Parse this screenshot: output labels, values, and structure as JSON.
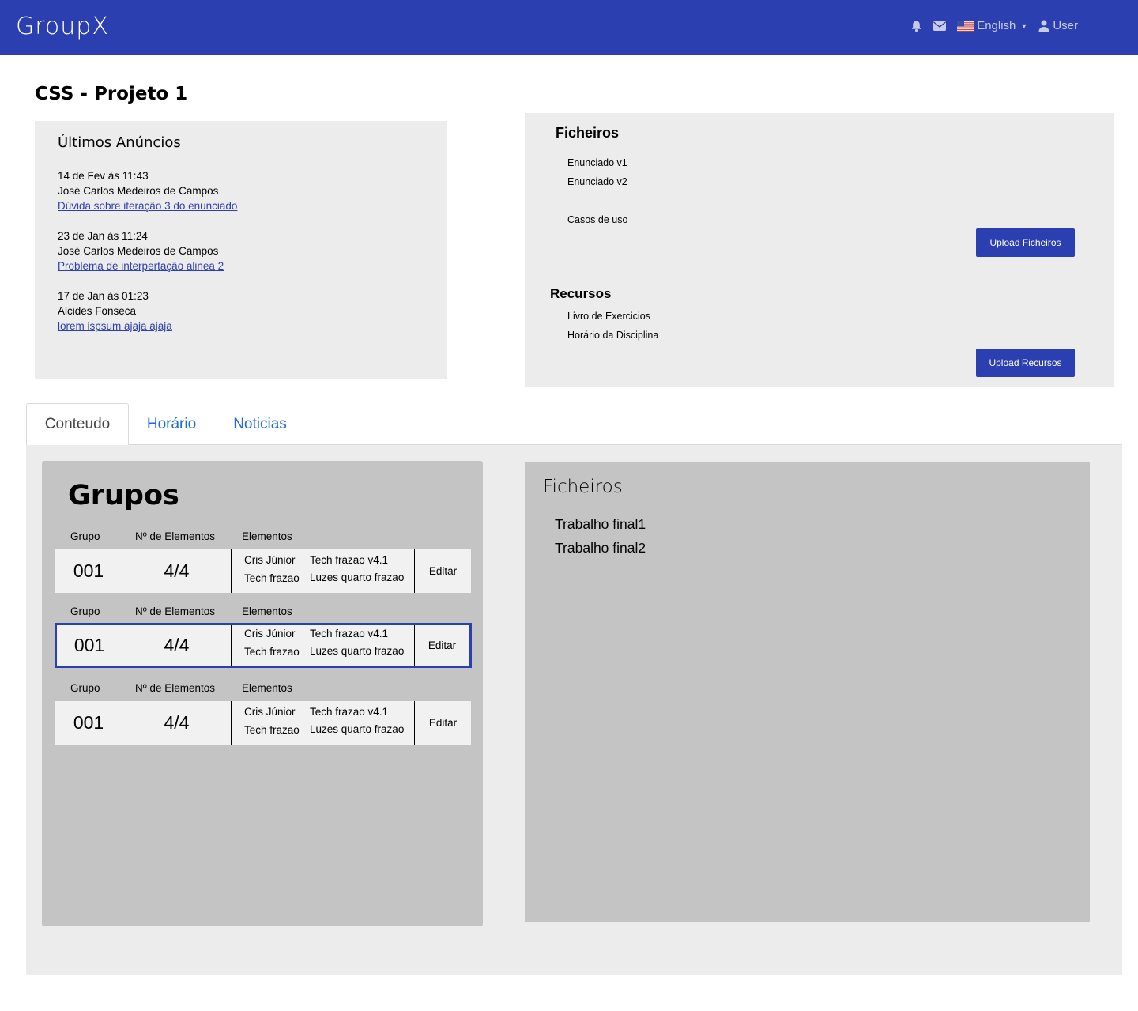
{
  "header": {
    "logo": "GroupX",
    "language": "English",
    "user": "User"
  },
  "page_title": "CSS - Projeto 1",
  "anuncios": {
    "title": "Últimos Anúncios",
    "items": [
      {
        "date": "14 de Fev às 11:43",
        "author": "José Carlos Medeiros de Campos",
        "link": "Dúvida sobre iteração 3 do enunciado"
      },
      {
        "date": "23 de Jan às 11:24",
        "author": "José Carlos Medeiros de Campos",
        "link": "Problema de interpertação alinea 2"
      },
      {
        "date": "17 de Jan às 01:23",
        "author": "Alcides Fonseca",
        "link": "lorem ispsum ajaja ajaja"
      }
    ]
  },
  "ficheiros_top": {
    "title": "Ficheiros",
    "files": [
      "Enunciado v1",
      "Enunciado v2",
      "Casos de uso"
    ],
    "upload_label": "Upload Ficheiros"
  },
  "recursos": {
    "title": "Recursos",
    "items": [
      "Livro de Exercicios",
      "Horário da Disciplina"
    ],
    "upload_label": "Upload Recursos"
  },
  "tabs": [
    "Conteudo",
    "Horário",
    "Noticias"
  ],
  "grupos": {
    "title": "Grupos",
    "headers": {
      "grupo": "Grupo",
      "n_elementos": "Nº de Elementos",
      "elementos": "Elementos"
    },
    "rows": [
      {
        "grupo": "001",
        "count": "4/4",
        "members": [
          "Cris Júnior",
          "Tech frazao v4.1",
          "Tech frazao",
          "Luzes quarto frazao"
        ],
        "action": "Editar"
      },
      {
        "grupo": "001",
        "count": "4/4",
        "members": [
          "Cris Júnior",
          "Tech frazao v4.1",
          "Tech frazao",
          "Luzes quarto frazao"
        ],
        "action": "Editar"
      },
      {
        "grupo": "001",
        "count": "4/4",
        "members": [
          "Cris Júnior",
          "Tech frazao v4.1",
          "Tech frazao",
          "Luzes quarto frazao"
        ],
        "action": "Editar"
      }
    ]
  },
  "ficheiros_bottom": {
    "title": "Ficheiros",
    "files": [
      "Trabalho final1",
      "Trabalho final2"
    ]
  },
  "colors": {
    "brand": "#2c3fb1",
    "panel": "#ececec",
    "card": "#c4c4c4",
    "tab_link": "#1f6ad6"
  }
}
